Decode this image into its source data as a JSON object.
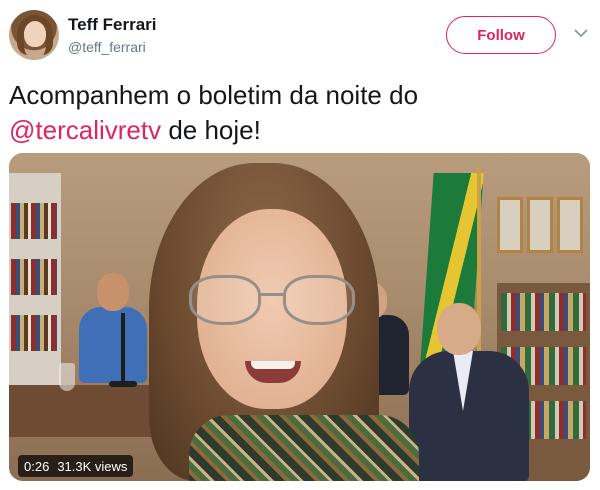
{
  "tweet": {
    "author": {
      "display_name": "Teff Ferrari",
      "handle": "@teff_ferrari"
    },
    "follow_label": "Follow",
    "text_before": "Acompanhem o boletim da noite do",
    "mention": "@tercalivretv",
    "text_after": " de hoje!",
    "video": {
      "duration": "0:26",
      "views": "31.3K views"
    }
  },
  "colors": {
    "accent": "#e0245e",
    "handle_gray": "#657786",
    "text": "#14171a"
  },
  "icons": {
    "caret": "chevron-down-icon"
  }
}
